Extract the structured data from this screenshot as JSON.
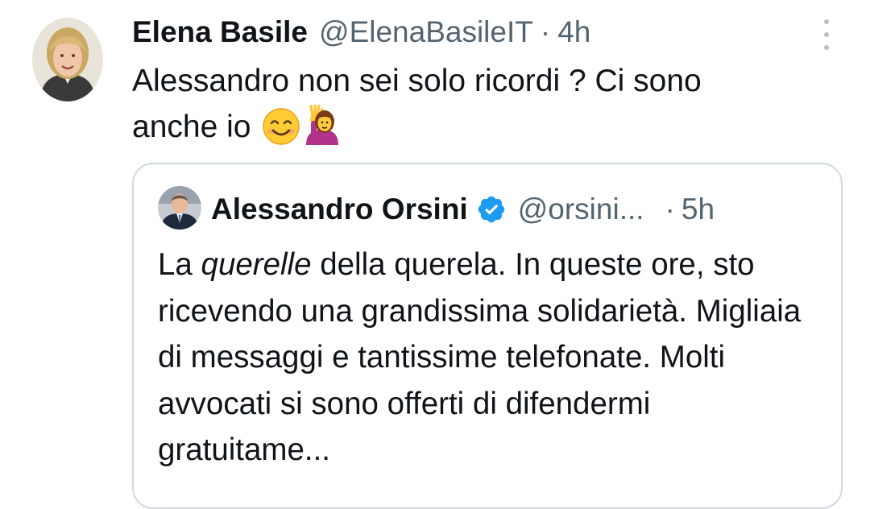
{
  "tweet": {
    "author_name": "Elena Basile",
    "author_handle": "@ElenaBasileIT",
    "separator": "·",
    "time": "4h",
    "text_line1": "Alessandro non sei solo ricordi ? Ci sono",
    "text_line2": "anche io",
    "emojis": [
      "smiling-face-icon",
      "woman-raising-hand-icon"
    ]
  },
  "quoted_tweet": {
    "author_name": "Alessandro Orsini",
    "verified": true,
    "author_handle": "@orsini...",
    "separator": "·",
    "time": "5h",
    "text_before_italic": "La ",
    "text_italic": "querelle",
    "text_after_italic": " della querela. In queste ore, sto ricevendo una grandissima solidarietà. Migliaia di messaggi e tantissime telefonate. Molti avvocati si sono offerti di difendermi gratuitame..."
  },
  "colors": {
    "text_primary": "#0f1419",
    "text_secondary": "#536471",
    "border": "#cfd9de",
    "verified": "#1d9bf0"
  }
}
